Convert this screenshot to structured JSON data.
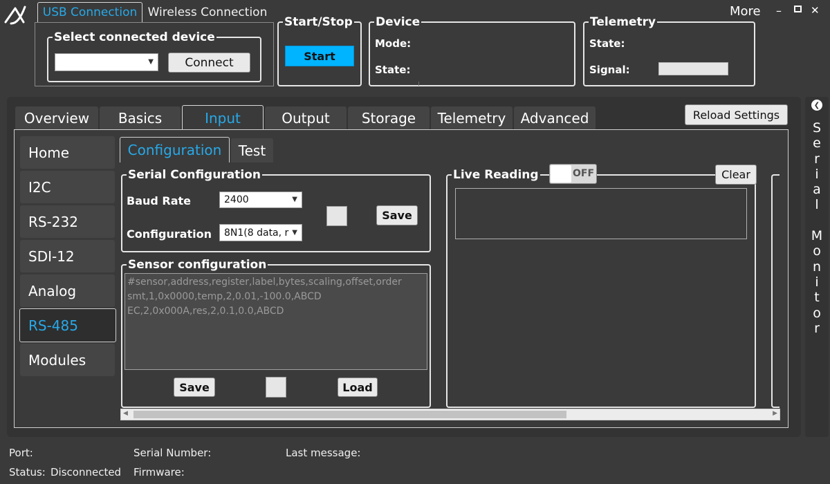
{
  "window": {
    "more_label": "More",
    "minimize_glyph": "–",
    "maximize_glyph": "▫",
    "close_glyph": "✕"
  },
  "connection_tabs": [
    {
      "label": "USB Connection",
      "active": true
    },
    {
      "label": "Wireless Connection",
      "active": false
    }
  ],
  "select_device": {
    "title": "Select connected device",
    "value": "",
    "connect_label": "Connect"
  },
  "start_stop": {
    "title": "Start/Stop",
    "start_label": "Start"
  },
  "device": {
    "title": "Device",
    "mode_label": "Mode:",
    "state_label": "State:"
  },
  "telemetry_top": {
    "title": "Telemetry",
    "state_label": "State:",
    "signal_label": "Signal:"
  },
  "main_tabs": [
    {
      "label": "Overview",
      "active": false
    },
    {
      "label": "Basics",
      "active": false
    },
    {
      "label": "Input",
      "active": true
    },
    {
      "label": "Output",
      "active": false
    },
    {
      "label": "Storage",
      "active": false
    },
    {
      "label": "Telemetry",
      "active": false
    },
    {
      "label": "Advanced",
      "active": false
    }
  ],
  "reload_label": "Reload Settings",
  "sidebar": [
    {
      "label": "Home",
      "active": false
    },
    {
      "label": "I2C",
      "active": false
    },
    {
      "label": "RS-232",
      "active": false
    },
    {
      "label": "SDI-12",
      "active": false
    },
    {
      "label": "Analog",
      "active": false
    },
    {
      "label": "RS-485",
      "active": true
    },
    {
      "label": "Modules",
      "active": false
    }
  ],
  "sub_tabs": [
    {
      "label": "Configuration",
      "active": true
    },
    {
      "label": "Test",
      "active": false
    }
  ],
  "serial_config": {
    "title": "Serial Configuration",
    "baud_label": "Baud Rate",
    "baud_value": "2400",
    "config_label": "Configuration",
    "config_value": "8N1(8 data, r",
    "save_label": "Save"
  },
  "sensor_config": {
    "title": "Sensor configuration",
    "lines": [
      "#sensor,address,register,label,bytes,scaling,offset,order",
      "smt,1,0x0000,temp,2,0.01,-100.0,ABCD",
      "EC,2,0x000A,res,2,0.1,0.0,ABCD"
    ],
    "save_label": "Save",
    "load_label": "Load"
  },
  "live_reading": {
    "title": "Live Reading",
    "toggle_label": "OFF",
    "toggle_on": false,
    "clear_label": "Clear"
  },
  "serial_monitor": {
    "letters": [
      "S",
      "e",
      "r",
      "i",
      "a",
      "l",
      " ",
      "M",
      "o",
      "n",
      "i",
      "t",
      "o",
      "r"
    ]
  },
  "status_bar": {
    "port_label": "Port:",
    "status_label": "Status:",
    "status_value": "Disconnected",
    "serial_label": "Serial Number:",
    "firmware_label": "Firmware:",
    "last_message_label": "Last message:"
  },
  "colors": {
    "accent": "#27a9e8",
    "start_button": "#00b4ff",
    "background": "#3a3a3a"
  }
}
